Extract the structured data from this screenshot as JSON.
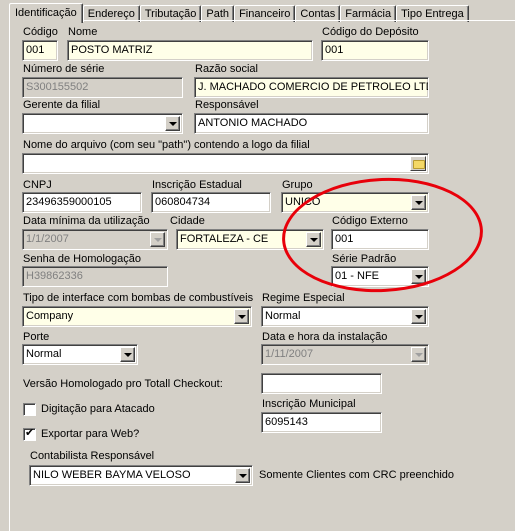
{
  "tabs": [
    {
      "label": "Identificação",
      "active": true
    },
    {
      "label": "Endereço"
    },
    {
      "label": "Tributação"
    },
    {
      "label": "Path"
    },
    {
      "label": "Financeiro"
    },
    {
      "label": "Contas"
    },
    {
      "label": "Farmácia"
    },
    {
      "label": "Tipo Entrega"
    }
  ],
  "form": {
    "codigo": {
      "label": "Código",
      "value": "001"
    },
    "nome": {
      "label": "Nome",
      "value": "POSTO MATRIZ"
    },
    "codigo_deposito": {
      "label": "Código do Depósito",
      "value": "001"
    },
    "numero_serie": {
      "label": "Número de série",
      "value": "S300155502"
    },
    "razao_social": {
      "label": "Razão social",
      "value": "J. MACHADO COMERCIO DE PETROLEO LTDA"
    },
    "gerente": {
      "label": "Gerente da filial",
      "value": ""
    },
    "responsavel": {
      "label": "Responsável",
      "value": "ANTONIO MACHADO"
    },
    "logo_path": {
      "label": "Nome do arquivo (com seu \"path\") contendo a logo da filial",
      "value": ""
    },
    "cnpj": {
      "label": "CNPJ",
      "value": "23496359000105"
    },
    "inscricao_estadual": {
      "label": "Inscrição Estadual",
      "value": "060804734"
    },
    "grupo": {
      "label": "Grupo",
      "value": "UNICO"
    },
    "data_minima": {
      "label": "Data mínima da utilização",
      "value": "1/1/2007"
    },
    "cidade": {
      "label": "Cidade",
      "value": "FORTALEZA - CE"
    },
    "codigo_externo": {
      "label": "Código Externo",
      "value": "001"
    },
    "senha_homologacao": {
      "label": "Senha de Homologação",
      "value": "H39862336"
    },
    "serie_padrao": {
      "label": "Série Padrão",
      "value": "01 - NFE"
    },
    "tipo_interface": {
      "label": "Tipo de interface com bombas de combustíveis",
      "value": "Company"
    },
    "regime_especial": {
      "label": "Regime Especial",
      "value": "Normal"
    },
    "porte": {
      "label": "Porte",
      "value": "Normal"
    },
    "data_instalacao": {
      "label": "Data e hora da instalação",
      "value": "1/11/2007"
    },
    "versao_homologado": {
      "label": "Versão Homologado pro Totall Checkout:",
      "value": ""
    },
    "digitacao_atacado": {
      "label": "Digitação para Atacado",
      "checked": false
    },
    "exportar_web": {
      "label": "Exportar para Web?",
      "checked": true,
      "mark": "✔"
    },
    "inscricao_municipal": {
      "label": "Inscrição Municipal",
      "value": "6095143"
    },
    "contabilista": {
      "label": "Contabilista Responsável",
      "value": "NILO WEBER BAYMA VELOSO"
    },
    "somente_clientes": {
      "label": "Somente Clientes com  CRC preenchido"
    }
  },
  "annotation": {
    "color": "#e8000a",
    "shape": "ellipse"
  }
}
